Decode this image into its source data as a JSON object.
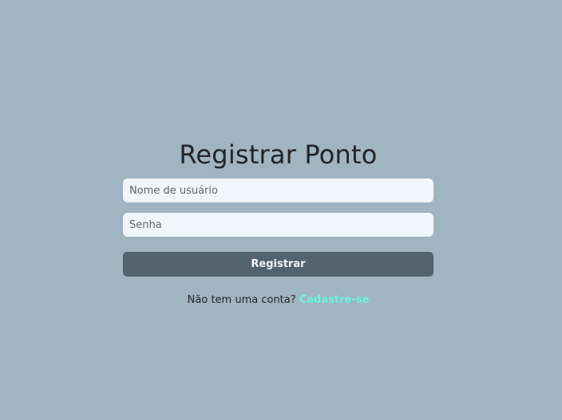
{
  "login": {
    "title": "Registrar Ponto",
    "username_placeholder": "Nome de usuário",
    "username_value": "",
    "password_placeholder": "Senha",
    "password_value": "",
    "submit_label": "Registrar",
    "signup_prompt": "Não tem uma conta?",
    "signup_link": "Cadastre-se"
  },
  "colors": {
    "background": "#a1b4c2",
    "button": "#52636d",
    "link": "#6ff3e0",
    "input": "#f1f6fb"
  }
}
